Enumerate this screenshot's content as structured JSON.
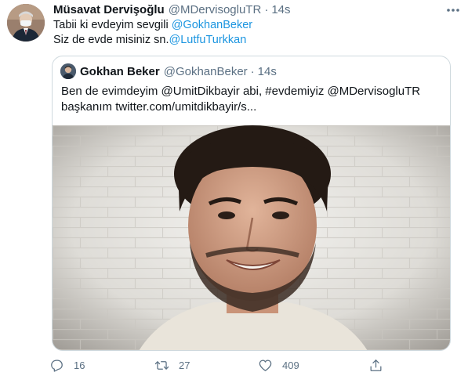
{
  "tweet": {
    "author": {
      "display_name": "Müsavat Dervişoğlu",
      "handle": "@MDervisogluTR",
      "separator": "·",
      "time": "14s"
    },
    "more_icon": "ellipsis-icon",
    "body": {
      "line1_text": "Tabii ki evdeyim sevgili ",
      "line1_mention": "@GokhanBeker",
      "line2_text": "Siz de evde misiniz sn.",
      "line2_mention": "@LutfuTurkkan"
    },
    "quoted": {
      "display_name": "Gokhan Beker",
      "handle": "@GokhanBeker",
      "separator": "·",
      "time": "14s",
      "text_line1": "Ben de evimdeyim @UmitDikbayir abi, #evdemiyiz @MDervisogluTR",
      "text_line2": "başkanım  twitter.com/umitdikbayir/s..."
    },
    "actions": {
      "reply_count": "16",
      "retweet_count": "27",
      "like_count": "409",
      "reply_icon": "reply-icon",
      "retweet_icon": "retweet-icon",
      "like_icon": "heart-icon",
      "share_icon": "share-icon"
    },
    "colors": {
      "link": "#1b95e0",
      "secondary_text": "#5b7083",
      "border": "#cfd9de"
    }
  }
}
